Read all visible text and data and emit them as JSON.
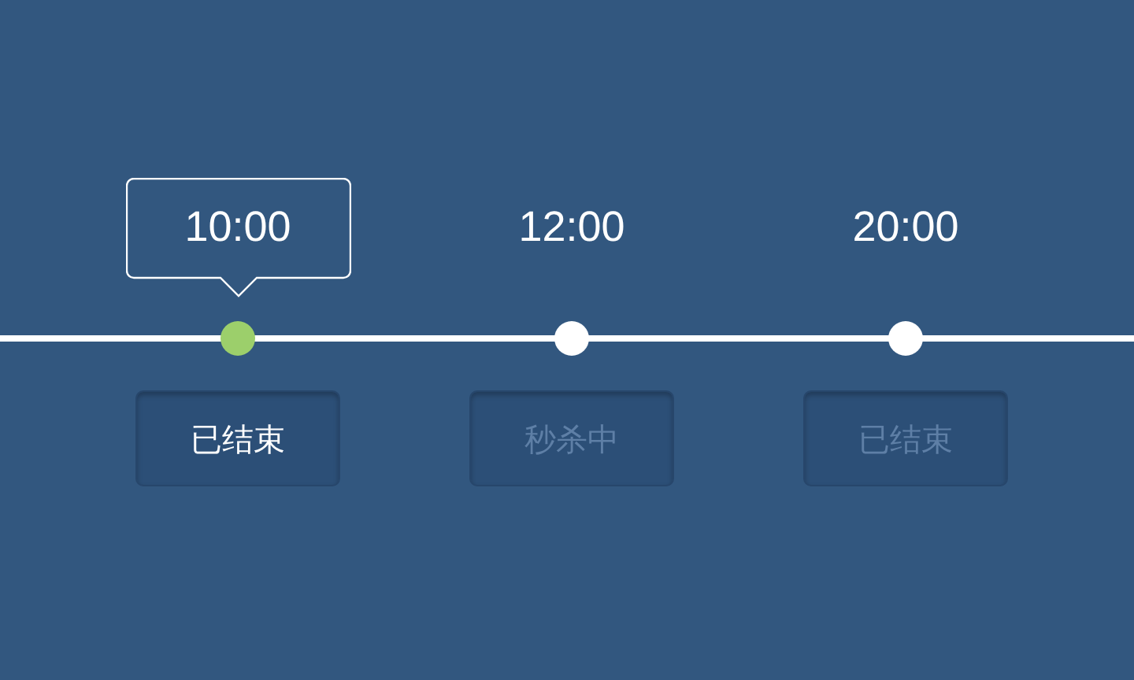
{
  "timeline": [
    {
      "time": "10:00",
      "status": "已结束",
      "selected": true
    },
    {
      "time": "12:00",
      "status": "秒杀中",
      "selected": false
    },
    {
      "time": "20:00",
      "status": "已结束",
      "selected": false
    }
  ]
}
